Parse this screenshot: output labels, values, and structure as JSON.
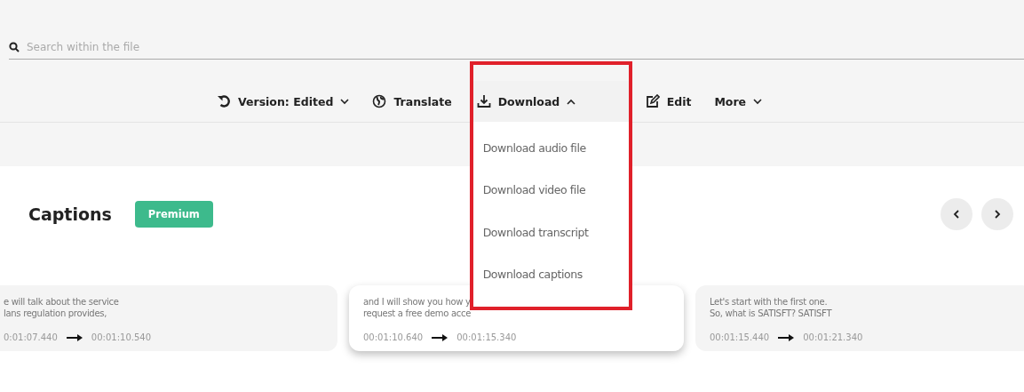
{
  "search": {
    "placeholder": "Search within the file"
  },
  "toolbar": [
    {
      "kind": "version",
      "label": "Version: Edited",
      "expanded": false
    },
    {
      "kind": "translate",
      "label": "Translate"
    },
    {
      "kind": "download",
      "label": "Download",
      "expanded": true
    },
    {
      "kind": "edit",
      "label": "Edit"
    },
    {
      "kind": "more",
      "label": "More",
      "expanded": false
    }
  ],
  "download_menu": [
    "Download audio file",
    "Download video file",
    "Download transcript",
    "Download captions"
  ],
  "captions": {
    "title": "Captions",
    "badge": "Premium",
    "cards": [
      {
        "lines": [
          "e will talk about the service",
          "lans regulation provides,"
        ],
        "start": "0:01:07.440",
        "end": "00:01:10.540",
        "selected": false
      },
      {
        "lines": [
          "and I will show you how y",
          "request a free demo acce"
        ],
        "start": "00:01:10.640",
        "end": "00:01:15.340",
        "selected": true
      },
      {
        "lines": [
          "Let's start with the first one.",
          "So, what is SATISFT? SATISFT"
        ],
        "start": "00:01:15.440",
        "end": "00:01:21.340",
        "selected": false
      }
    ]
  }
}
